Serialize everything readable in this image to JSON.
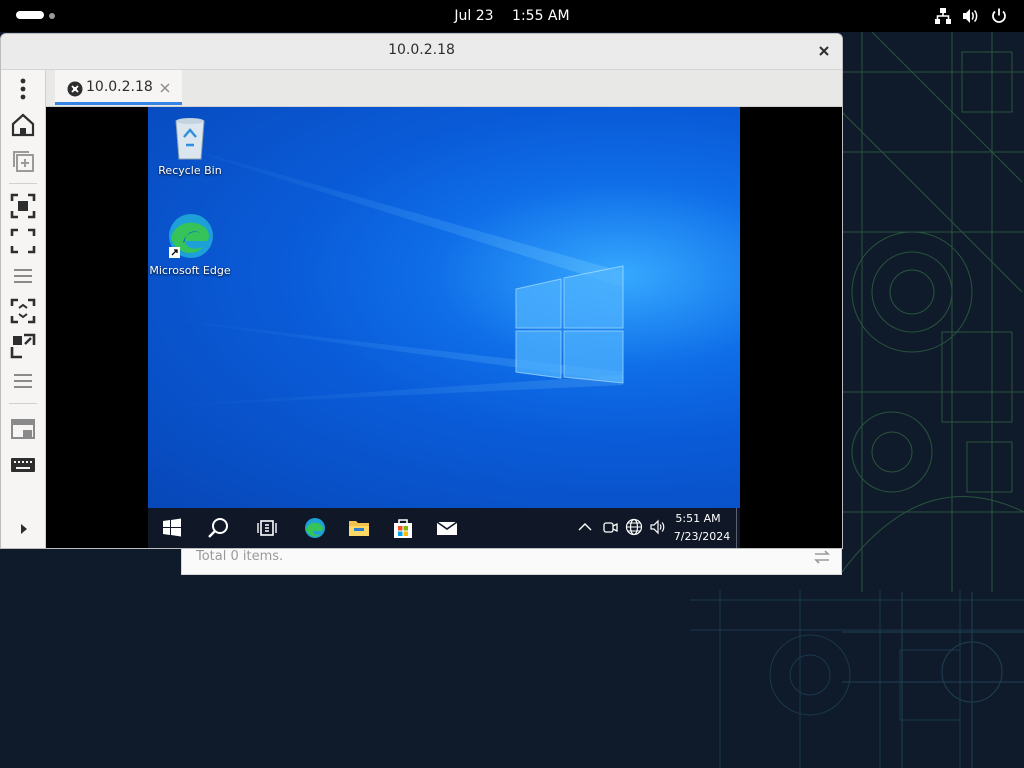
{
  "topbar": {
    "date": "Jul 23",
    "time": "1:55 AM"
  },
  "window": {
    "title": "10.0.2.18",
    "tab_label": "10.0.2.18"
  },
  "behind_window": {
    "status": "Total 0 items."
  },
  "remote_desktop": {
    "icons": [
      {
        "label": "Recycle Bin",
        "icon": "recycle-bin-icon"
      },
      {
        "label": "Microsoft Edge",
        "icon": "edge-icon"
      }
    ],
    "taskbar": {
      "time": "5:51 AM",
      "date": "7/23/2024"
    }
  },
  "colors": {
    "accent": "#3584e4",
    "desktop_blue": "#0a5bd8",
    "taskbar": "#101827"
  }
}
